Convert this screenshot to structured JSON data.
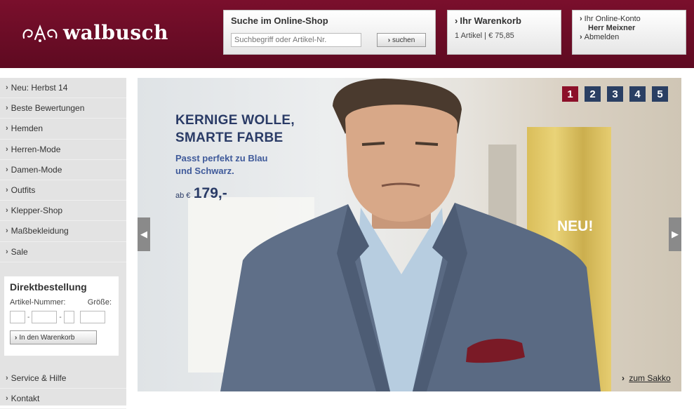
{
  "brand": {
    "name": "walbusch"
  },
  "search": {
    "title": "Suche im Online-Shop",
    "placeholder": "Suchbegriff oder Artikel-Nr.",
    "button": "suchen"
  },
  "cart": {
    "title": "Ihr Warenkorb",
    "summary": "1 Artikel | € 75,85"
  },
  "account": {
    "title": "Ihr Online-Konto",
    "user": "Herr Meixner",
    "logout": "Abmelden"
  },
  "sidebar": {
    "items": [
      {
        "label": "Neu: Herbst 14"
      },
      {
        "label": "Beste Bewertungen"
      },
      {
        "label": "Hemden"
      },
      {
        "label": "Herren-Mode"
      },
      {
        "label": "Damen-Mode"
      },
      {
        "label": "Outfits"
      },
      {
        "label": "Klepper-Shop"
      },
      {
        "label": "Maßbekleidung"
      },
      {
        "label": "Sale"
      }
    ],
    "bottom_items": [
      {
        "label": "Service & Hilfe"
      },
      {
        "label": "Kontakt"
      }
    ]
  },
  "direct_order": {
    "title": "Direktbestellung",
    "article_label": "Artikel-Nummer:",
    "size_label": "Größe:",
    "separator": "-",
    "button": "In den Warenkorb"
  },
  "hero": {
    "headline_1": "KERNIGE WOLLE,",
    "headline_2": "SMARTE FARBE",
    "sub_1": "Passt perfekt zu Blau",
    "sub_2": "und Schwarz.",
    "price_prefix": "ab €",
    "price": "179,-",
    "badge": "NEU!",
    "link": "zum Sakko",
    "pages": [
      "1",
      "2",
      "3",
      "4",
      "5"
    ],
    "active_page": "1"
  },
  "colors": {
    "brand": "#7a0f2c",
    "pager": "#2a3f63",
    "pager_active": "#8c1029",
    "headline": "#2a3b66"
  }
}
